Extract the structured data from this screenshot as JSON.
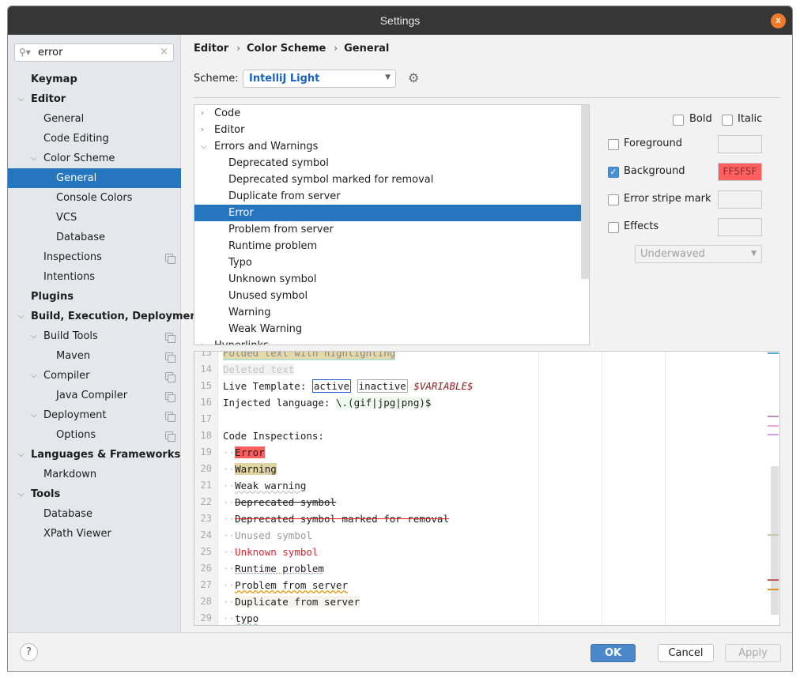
{
  "window": {
    "title": "Settings",
    "close_label": "x"
  },
  "search": {
    "value": "error",
    "clear_icon": "×"
  },
  "sidebar": {
    "items": [
      {
        "label": "Keymap",
        "level": 0,
        "bold": true,
        "chevron": "",
        "project": false
      },
      {
        "label": "Editor",
        "level": 0,
        "bold": true,
        "chevron": "expanded",
        "project": false
      },
      {
        "label": "General",
        "level": 1,
        "bold": false,
        "chevron": "",
        "project": false
      },
      {
        "label": "Code Editing",
        "level": 1,
        "bold": false,
        "chevron": "",
        "project": false
      },
      {
        "label": "Color Scheme",
        "level": 1,
        "bold": false,
        "chevron": "expanded",
        "project": false
      },
      {
        "label": "General",
        "level": 2,
        "bold": false,
        "chevron": "",
        "project": false,
        "selected": true
      },
      {
        "label": "Console Colors",
        "level": 2,
        "bold": false,
        "chevron": "",
        "project": false
      },
      {
        "label": "VCS",
        "level": 2,
        "bold": false,
        "chevron": "",
        "project": false
      },
      {
        "label": "Database",
        "level": 2,
        "bold": false,
        "chevron": "",
        "project": false
      },
      {
        "label": "Inspections",
        "level": 1,
        "bold": false,
        "chevron": "",
        "project": true
      },
      {
        "label": "Intentions",
        "level": 1,
        "bold": false,
        "chevron": "",
        "project": false
      },
      {
        "label": "Plugins",
        "level": 0,
        "bold": true,
        "chevron": "",
        "project": false
      },
      {
        "label": "Build, Execution, Deployment",
        "level": 0,
        "bold": true,
        "chevron": "expanded",
        "project": false
      },
      {
        "label": "Build Tools",
        "level": 1,
        "bold": false,
        "chevron": "expanded",
        "project": true
      },
      {
        "label": "Maven",
        "level": 2,
        "bold": false,
        "chevron": "",
        "project": true
      },
      {
        "label": "Compiler",
        "level": 1,
        "bold": false,
        "chevron": "expanded",
        "project": true
      },
      {
        "label": "Java Compiler",
        "level": 2,
        "bold": false,
        "chevron": "",
        "project": true
      },
      {
        "label": "Deployment",
        "level": 1,
        "bold": false,
        "chevron": "expanded",
        "project": true
      },
      {
        "label": "Options",
        "level": 2,
        "bold": false,
        "chevron": "",
        "project": true
      },
      {
        "label": "Languages & Frameworks",
        "level": 0,
        "bold": true,
        "chevron": "expanded",
        "project": false
      },
      {
        "label": "Markdown",
        "level": 1,
        "bold": false,
        "chevron": "",
        "project": false
      },
      {
        "label": "Tools",
        "level": 0,
        "bold": true,
        "chevron": "expanded",
        "project": false
      },
      {
        "label": "Database",
        "level": 1,
        "bold": false,
        "chevron": "",
        "project": false
      },
      {
        "label": "XPath Viewer",
        "level": 1,
        "bold": false,
        "chevron": "",
        "project": false
      }
    ]
  },
  "breadcrumb": [
    "Editor",
    "Color Scheme",
    "General"
  ],
  "scheme": {
    "label": "Scheme:",
    "value": "IntelliJ Light"
  },
  "attributes": {
    "rows": [
      {
        "label": "Code",
        "level": 0,
        "chevron": "collapsed"
      },
      {
        "label": "Editor",
        "level": 0,
        "chevron": "collapsed"
      },
      {
        "label": "Errors and Warnings",
        "level": 0,
        "chevron": "expanded"
      },
      {
        "label": "Deprecated symbol",
        "level": 1,
        "chevron": ""
      },
      {
        "label": "Deprecated symbol marked for removal",
        "level": 1,
        "chevron": ""
      },
      {
        "label": "Duplicate from server",
        "level": 1,
        "chevron": ""
      },
      {
        "label": "Error",
        "level": 1,
        "chevron": "",
        "selected": true
      },
      {
        "label": "Problem from server",
        "level": 1,
        "chevron": ""
      },
      {
        "label": "Runtime problem",
        "level": 1,
        "chevron": ""
      },
      {
        "label": "Typo",
        "level": 1,
        "chevron": ""
      },
      {
        "label": "Unknown symbol",
        "level": 1,
        "chevron": ""
      },
      {
        "label": "Unused symbol",
        "level": 1,
        "chevron": ""
      },
      {
        "label": "Warning",
        "level": 1,
        "chevron": ""
      },
      {
        "label": "Weak Warning",
        "level": 1,
        "chevron": ""
      },
      {
        "label": "Hyperlinks",
        "level": 0,
        "chevron": "collapsed",
        "cut": true
      }
    ]
  },
  "properties": {
    "bold": {
      "label": "Bold",
      "checked": false
    },
    "italic": {
      "label": "Italic",
      "checked": false
    },
    "foreground": {
      "label": "Foreground",
      "checked": false,
      "color": ""
    },
    "background": {
      "label": "Background",
      "checked": true,
      "color": "FF5F5F"
    },
    "error_stripe": {
      "label": "Error stripe mark",
      "checked": false,
      "color": ""
    },
    "effects": {
      "label": "Effects",
      "checked": false,
      "color": "",
      "type": "Underwaved"
    }
  },
  "preview": {
    "lines": [
      {
        "n": "13",
        "text": "Folded text with highlighting",
        "style": "folded"
      },
      {
        "n": "14",
        "text": "Deleted text",
        "style": "deleted"
      },
      {
        "n": "15",
        "parts": [
          {
            "t": "Live Template: ",
            "s": "plain"
          },
          {
            "t": "active",
            "s": "lt-active"
          },
          {
            "t": " ",
            "s": "plain"
          },
          {
            "t": "inactive",
            "s": "lt-inactive"
          },
          {
            "t": " ",
            "s": "plain"
          },
          {
            "t": "$VARIABLE$",
            "s": "lt-var"
          }
        ]
      },
      {
        "n": "16",
        "parts": [
          {
            "t": "Injected language: ",
            "s": "plain"
          },
          {
            "t": "\\.(gif|jpg|png)$",
            "s": "injected"
          }
        ]
      },
      {
        "n": "17",
        "text": "",
        "style": "plain"
      },
      {
        "n": "18",
        "text": "Code Inspections:",
        "style": "plain"
      },
      {
        "n": "19",
        "text": "Error",
        "style": "error",
        "indent": true
      },
      {
        "n": "20",
        "text": "Warning",
        "style": "warning",
        "indent": true
      },
      {
        "n": "21",
        "text": "Weak warning",
        "style": "weak-warning",
        "indent": true
      },
      {
        "n": "22",
        "text": "Deprecated symbol",
        "style": "deprecated",
        "indent": true
      },
      {
        "n": "23",
        "text": "Deprecated symbol marked for removal",
        "style": "removal",
        "indent": true
      },
      {
        "n": "24",
        "text": "Unused symbol",
        "style": "unused",
        "indent": true
      },
      {
        "n": "25",
        "text": "Unknown symbol",
        "style": "unknown",
        "indent": true
      },
      {
        "n": "26",
        "text": "Runtime problem",
        "style": "runtime",
        "indent": true
      },
      {
        "n": "27",
        "text": "Problem from server",
        "style": "server-problem",
        "indent": true
      },
      {
        "n": "28",
        "text": "Duplicate from server",
        "style": "duplicate",
        "indent": true
      },
      {
        "n": "29",
        "text": "typo",
        "style": "typo",
        "indent": true
      }
    ],
    "stripe_markers": [
      "#5aa8e0",
      "#b394b8",
      "#eaa7d8",
      "#cf9ff4",
      "#cbc6a8",
      "#c45c5c",
      "#dd9224"
    ]
  },
  "colors": {
    "accent": "#2675bf",
    "error_bg": "#ff5f5f",
    "warning_bg": "#e0d4a3",
    "unknown_fg": "#e0252f"
  },
  "footer": {
    "help_label": "?",
    "ok_label": "OK",
    "cancel_label": "Cancel",
    "apply_label": "Apply"
  }
}
